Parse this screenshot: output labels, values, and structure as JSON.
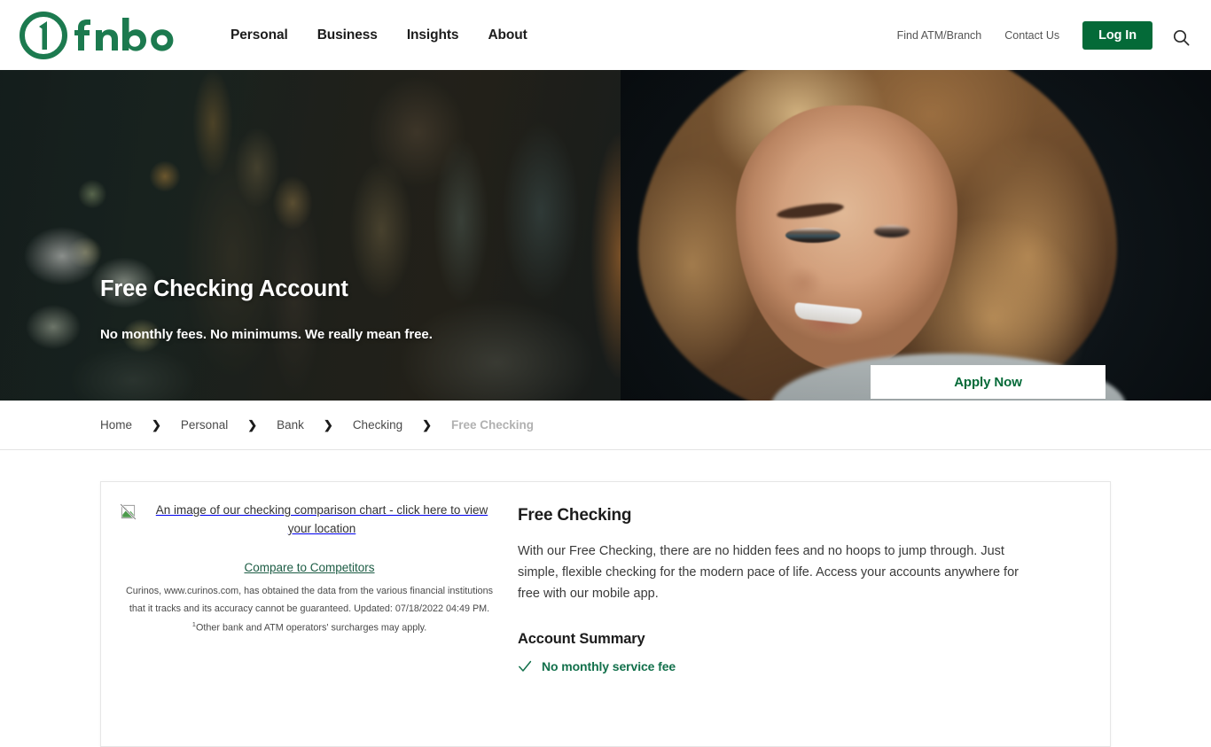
{
  "brand": {
    "name": "fnbo",
    "logo_mark": "circle-one-logo",
    "green": "#046a38",
    "dark_green": "#1c5c44",
    "accent_green": "#12704b"
  },
  "header": {
    "nav": [
      {
        "label": "Personal"
      },
      {
        "label": "Business"
      },
      {
        "label": "Insights"
      },
      {
        "label": "About"
      }
    ],
    "utility": [
      {
        "label": "Find ATM/Branch"
      },
      {
        "label": "Contact Us"
      }
    ],
    "login_label": "Log In",
    "search_icon": "search-icon"
  },
  "hero": {
    "title": "Free Checking Account",
    "subtitle": "No monthly fees. No minimums. We really mean free.",
    "cta_label": "Apply Now"
  },
  "breadcrumb": {
    "separator": "❯",
    "items": [
      {
        "label": "Home",
        "current": false
      },
      {
        "label": "Personal",
        "current": false
      },
      {
        "label": "Bank",
        "current": false
      },
      {
        "label": "Checking",
        "current": false
      },
      {
        "label": "Free Checking",
        "current": true
      }
    ]
  },
  "card": {
    "left": {
      "image_alt": "An image of our checking comparison chart - click here to view your location",
      "image_icon": "broken-image-icon",
      "compare_link": "Compare to Competitors",
      "disclaimer_part1": "Curinos, www.curinos.com, has obtained the data from the various financial institutions that it tracks and its accuracy cannot be guaranteed. Updated: 07/18/2022 04:49 PM. ",
      "disclaimer_footnote_marker": "1",
      "disclaimer_part2": "Other bank and ATM operators' surcharges may apply."
    },
    "right": {
      "title": "Free Checking",
      "body": "With our Free Checking, there are no hidden fees and no hoops to jump through. Just simple, flexible checking for the modern pace of life. Access your accounts anywhere for free with our mobile app.",
      "summary_title": "Account Summary",
      "summary_items": [
        {
          "icon": "check-icon",
          "label": "No monthly service fee"
        }
      ]
    }
  }
}
